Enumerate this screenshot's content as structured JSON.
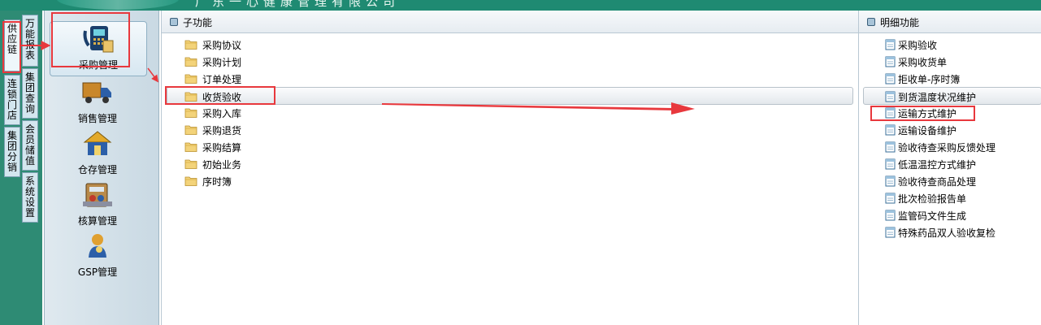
{
  "banner": {
    "title": "广东一心健康管理有限公司"
  },
  "vtabs": [
    {
      "label": "供应链",
      "active": true
    },
    {
      "label": "连锁门店"
    },
    {
      "label": "集团分销"
    },
    {
      "label": "万能报表"
    },
    {
      "label": "集团查询"
    },
    {
      "label": "会员储值"
    },
    {
      "label": "系统设置"
    }
  ],
  "modules": [
    {
      "label": "采购管理",
      "icon": "phone-icon",
      "active": true
    },
    {
      "label": "销售管理",
      "icon": "truck-icon"
    },
    {
      "label": "仓存管理",
      "icon": "warehouse-icon"
    },
    {
      "label": "核算管理",
      "icon": "calculator-icon"
    },
    {
      "label": "GSP管理",
      "icon": "person-icon"
    }
  ],
  "sub_panel": {
    "title": "子功能",
    "items": [
      {
        "label": "采购协议"
      },
      {
        "label": "采购计划"
      },
      {
        "label": "订单处理"
      },
      {
        "label": "收货验收",
        "selected": true
      },
      {
        "label": "采购入库"
      },
      {
        "label": "采购退货"
      },
      {
        "label": "采购结算"
      },
      {
        "label": "初始业务"
      },
      {
        "label": "序时簿"
      }
    ]
  },
  "detail_panel": {
    "title": "明细功能",
    "items": [
      {
        "label": "采购验收"
      },
      {
        "label": "采购收货单"
      },
      {
        "label": "拒收单-序时簿"
      },
      {
        "label": "到货温度状况维护",
        "selected": true
      },
      {
        "label": "运输方式维护"
      },
      {
        "label": "运输设备维护"
      },
      {
        "label": "验收待查采购反馈处理"
      },
      {
        "label": "低温温控方式维护"
      },
      {
        "label": "验收待查商品处理"
      },
      {
        "label": "批次检验报告单"
      },
      {
        "label": "监管码文件生成"
      },
      {
        "label": "特殊药品双人验收复检"
      }
    ]
  },
  "colors": {
    "accent": "#1f8a72",
    "annotation": "#e8383d"
  }
}
